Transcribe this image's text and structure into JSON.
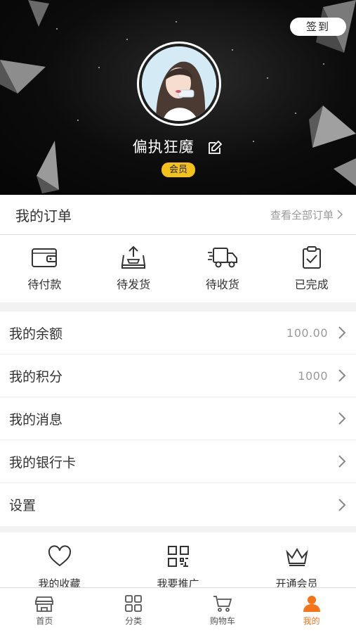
{
  "header": {
    "signin_label": "签到",
    "username": "偏执狂魔",
    "badge": "会员"
  },
  "orders": {
    "title": "我的订单",
    "view_all": "查看全部订单",
    "items": [
      {
        "label": "待付款",
        "icon": "wallet-icon"
      },
      {
        "label": "待发货",
        "icon": "package-out-icon"
      },
      {
        "label": "待收货",
        "icon": "truck-icon"
      },
      {
        "label": "已完成",
        "icon": "clipboard-check-icon"
      }
    ]
  },
  "menu": [
    {
      "label": "我的余额",
      "value": "100.00"
    },
    {
      "label": "我的积分",
      "value": "1000"
    },
    {
      "label": "我的消息",
      "value": ""
    },
    {
      "label": "我的银行卡",
      "value": ""
    },
    {
      "label": "设置",
      "value": ""
    }
  ],
  "extra": {
    "items": [
      {
        "label": "我的收藏",
        "icon": "heart-icon"
      },
      {
        "label": "我要推广",
        "icon": "qrcode-icon"
      },
      {
        "label": "开通会员",
        "icon": "crown-icon"
      }
    ]
  },
  "tabbar": {
    "items": [
      {
        "label": "首页",
        "icon": "store-icon"
      },
      {
        "label": "分类",
        "icon": "grid-icon"
      },
      {
        "label": "购物车",
        "icon": "cart-icon"
      },
      {
        "label": "我的",
        "icon": "user-icon"
      }
    ],
    "active_index": 3
  },
  "colors": {
    "accent": "#f57416",
    "badge": "#f2c21a",
    "header_bg": "#0c0c0c"
  }
}
